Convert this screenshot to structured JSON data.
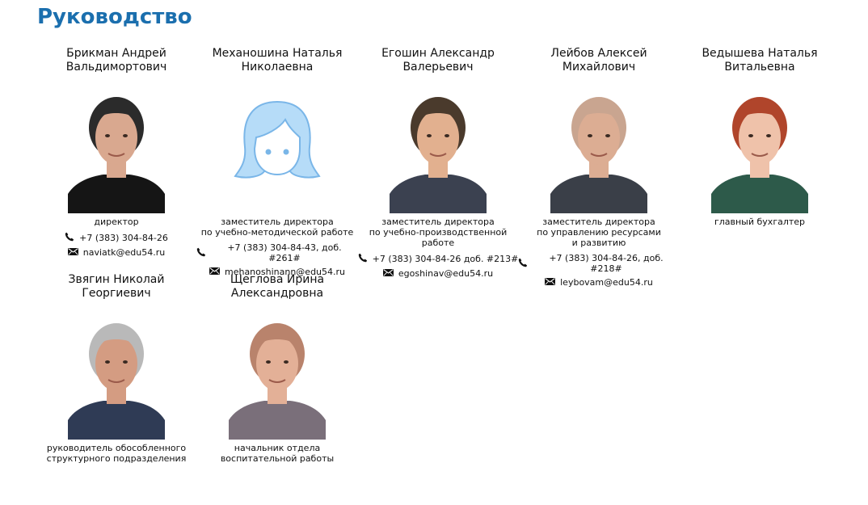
{
  "page_title": "Руководство",
  "staff": [
    {
      "name_line1": "Брикман Андрей",
      "name_line2": "Вальдимортович",
      "position": "директор",
      "phone": "+7 (383) 304-84-26",
      "email": "naviatk@edu54.ru",
      "skin": "#d9a88f",
      "hair": "#2b2b2b",
      "shirt": "#151515",
      "bg": "#ffffff"
    },
    {
      "name_line1": "Механошина Наталья",
      "name_line2": "Николаевна",
      "position": "заместитель директора\nпо учебно-методической работе",
      "phone": "+7 (383) 304-84-43, доб. #261#",
      "email": "mehanoshinann@edu54.ru",
      "placeholder": true
    },
    {
      "name_line1": "Егошин Александр",
      "name_line2": "Валерьевич",
      "position": "заместитель директора\nпо учебно-производственной\nработе",
      "phone": "+7 (383) 304-84-26 доб. #213#",
      "email": "egoshinav@edu54.ru",
      "skin": "#e2b08f",
      "hair": "#4a3a2c",
      "shirt": "#3b4150",
      "bg": "#ffffff"
    },
    {
      "name_line1": "Лейбов Алексей",
      "name_line2": "Михайлович",
      "position": "заместитель директора\nпо управлению ресурсами\nи развитию",
      "phone": "+7 (383) 304-84-26, доб. #218#",
      "email": "leybovam@edu54.ru",
      "skin": "#dcad93",
      "hair": "#c9a590",
      "shirt": "#3a3f48",
      "bg": "#ffffff"
    },
    {
      "name_line1": "Ведышева Наталья",
      "name_line2": "Витальевна",
      "position": "главный бухгалтер",
      "skin": "#efc2aa",
      "hair": "#b0452b",
      "shirt": "#2d5a4a",
      "bg": "#ffffff"
    },
    {
      "name_line1": "Звягин Николай",
      "name_line2": "Георгиевич",
      "position": "руководитель обособленного\nструктурного подразделения",
      "skin": "#d49c82",
      "hair": "#b9b9b9",
      "shirt": "#2f3b55",
      "bg": "#ffffff"
    },
    {
      "name_line1": "Щеглова Ирина",
      "name_line2": "Александровна",
      "position": "начальник отдела\nвоспитательной работы",
      "skin": "#e3b097",
      "hair": "#b9836c",
      "shirt": "#7a6f7a",
      "bg": "#ffffff"
    }
  ],
  "colors": {
    "title": "#1b6fae",
    "placeholder_icon": "#7ab6e8",
    "placeholder_fill": "#b6dcf8"
  },
  "icons": {
    "phone": "phone-icon",
    "email": "envelope-icon"
  }
}
